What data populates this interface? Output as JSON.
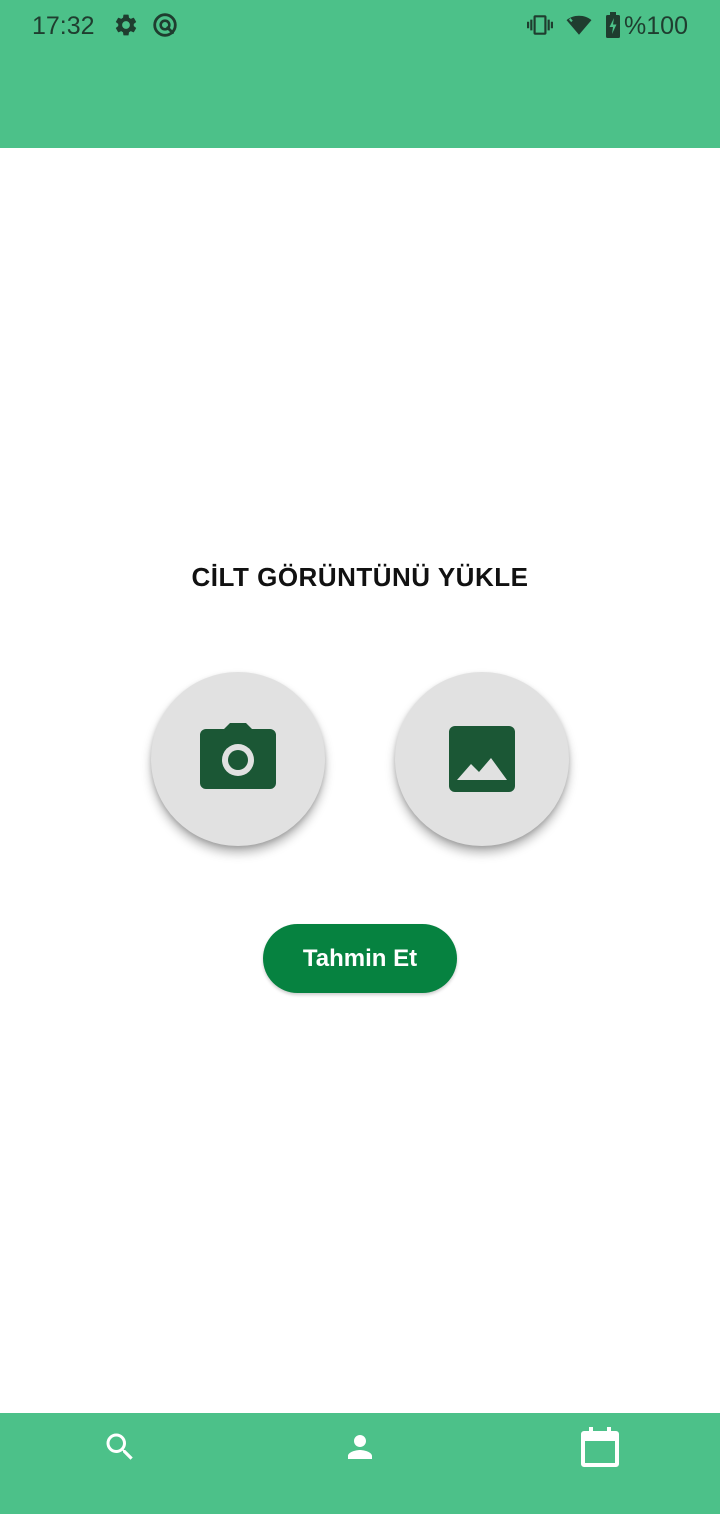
{
  "status_bar": {
    "time": "17:32",
    "battery_text": "%100",
    "icons": [
      "settings-icon",
      "sync-icon",
      "vibrate-icon",
      "wifi-icon",
      "battery-charging-icon"
    ]
  },
  "main": {
    "heading": "CİLT GÖRÜNTÜNÜ YÜKLE",
    "camera_button_icon": "camera-icon",
    "gallery_button_icon": "image-icon",
    "predict_button_label": "Tahmin Et"
  },
  "bottom_nav": {
    "items": [
      {
        "icon": "search-icon"
      },
      {
        "icon": "person-icon"
      },
      {
        "icon": "calendar-icon"
      }
    ]
  },
  "colors": {
    "primary": "#4cc189",
    "button": "#068240",
    "icon_dark": "#1b5735",
    "fab_background": "#e1e1e1"
  }
}
